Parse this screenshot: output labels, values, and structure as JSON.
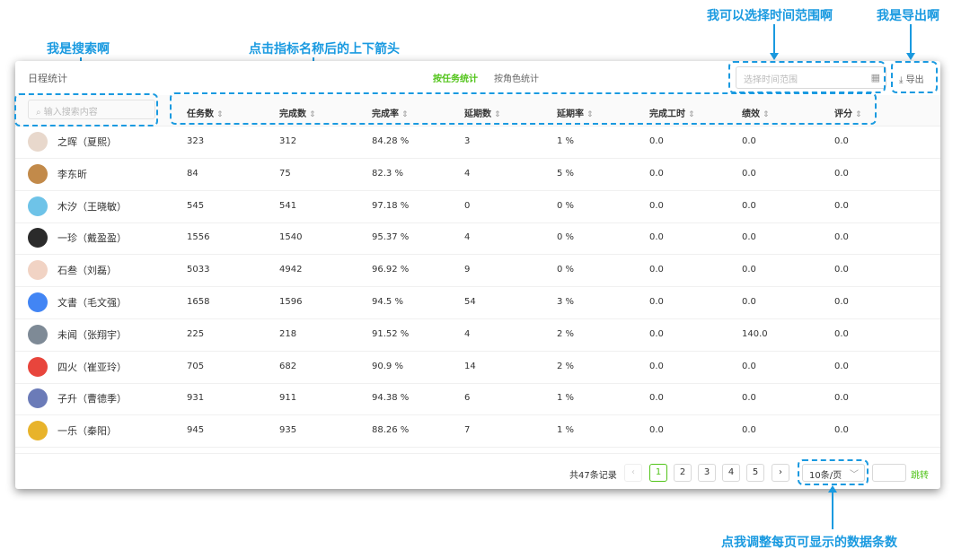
{
  "annotations": {
    "search": "我是搜索啊",
    "sort": "点击指标名称后的上下箭头",
    "date": "我可以选择时间范围啊",
    "export": "我是导出啊",
    "page_size": "点我调整每页可显示的数据条数"
  },
  "header": {
    "title": "日程统计",
    "tabs": [
      {
        "label": "按任务统计",
        "active": true
      },
      {
        "label": "按角色统计",
        "active": false
      }
    ],
    "date_placeholder": "选择时间范围",
    "export_label": "导出"
  },
  "search": {
    "placeholder": "输入搜索内容"
  },
  "columns": [
    "任务数",
    "完成数",
    "完成率",
    "延期数",
    "延期率",
    "完成工时",
    "绩效",
    "评分"
  ],
  "rows": [
    {
      "name": "之晖（夏熙）",
      "avatar_color": "#e8d8cc",
      "cells": [
        "323",
        "312",
        "84.28 %",
        "3",
        "1 %",
        "0.0",
        "0.0",
        "0.0"
      ]
    },
    {
      "name": "李东昕",
      "avatar_color": "#c28a4a",
      "cells": [
        "84",
        "75",
        "82.3 %",
        "4",
        "5 %",
        "0.0",
        "0.0",
        "0.0"
      ]
    },
    {
      "name": "木汐（王晓敏）",
      "avatar_color": "#6ec3e8",
      "cells": [
        "545",
        "541",
        "97.18 %",
        "0",
        "0 %",
        "0.0",
        "0.0",
        "0.0"
      ]
    },
    {
      "name": "一珍（戴盈盈）",
      "avatar_color": "#2b2b2b",
      "cells": [
        "1556",
        "1540",
        "95.37 %",
        "4",
        "0 %",
        "0.0",
        "0.0",
        "0.0"
      ]
    },
    {
      "name": "石叁（刘磊）",
      "avatar_color": "#f1d3c4",
      "cells": [
        "5033",
        "4942",
        "96.92 %",
        "9",
        "0 %",
        "0.0",
        "0.0",
        "0.0"
      ]
    },
    {
      "name": "文書（毛文强）",
      "avatar_color": "#4285f4",
      "cells": [
        "1658",
        "1596",
        "94.5 %",
        "54",
        "3 %",
        "0.0",
        "0.0",
        "0.0"
      ]
    },
    {
      "name": "未闻（张翔宇）",
      "avatar_color": "#7e8a96",
      "cells": [
        "225",
        "218",
        "91.52 %",
        "4",
        "2 %",
        "0.0",
        "140.0",
        "0.0"
      ]
    },
    {
      "name": "四火（崔亚玲）",
      "avatar_color": "#e8453c",
      "cells": [
        "705",
        "682",
        "90.9 %",
        "14",
        "2 %",
        "0.0",
        "0.0",
        "0.0"
      ]
    },
    {
      "name": "子升（曹德季）",
      "avatar_color": "#6b7bb8",
      "cells": [
        "931",
        "911",
        "94.38 %",
        "6",
        "1 %",
        "0.0",
        "0.0",
        "0.0"
      ]
    },
    {
      "name": "一乐（秦阳）",
      "avatar_color": "#e8b32b",
      "cells": [
        "945",
        "935",
        "88.26 %",
        "7",
        "1 %",
        "0.0",
        "0.0",
        "0.0"
      ]
    }
  ],
  "pagination": {
    "total_text": "共47条记录",
    "pages": [
      "1",
      "2",
      "3",
      "4",
      "5"
    ],
    "current_page": "1",
    "prev": "‹",
    "next": "›",
    "page_size": "10条/页",
    "jump_label": "跳转"
  },
  "colors": {
    "accent": "#52c41a",
    "annotation": "#1a9ae0"
  }
}
